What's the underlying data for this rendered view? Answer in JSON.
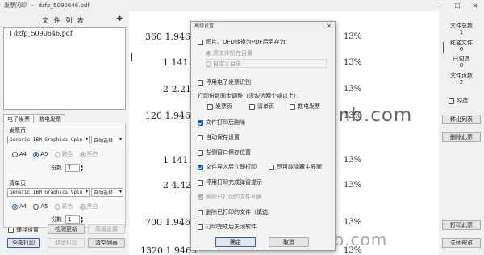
{
  "window": {
    "app_title": "发票闪印",
    "separator": "-",
    "file_title": "dzfp_5090646.pdf",
    "minimize": "—",
    "maximize": "☐",
    "close": "✕"
  },
  "file_list": {
    "header": "文 件 列 表",
    "header_icon": "✥",
    "items": [
      {
        "name": "dzfp_5090646.pdf",
        "checked": false
      }
    ]
  },
  "tabs": [
    "电子发票",
    "数电发票"
  ],
  "invoice_section": {
    "label": "发票页",
    "printer": "Generic IBM Graphics 9pin",
    "mode": "自动选择",
    "sizes": [
      "A4",
      "A5"
    ],
    "selected_size": "A5",
    "colors": [
      "彩色",
      "黑白"
    ],
    "selected_color": "黑白",
    "copies_label": "份数",
    "copies": "1"
  },
  "list_section": {
    "label": "清单页",
    "printer": "Generic IBM Graphics 9pin",
    "mode": "自动选择",
    "sizes": [
      "A4",
      "A5"
    ],
    "selected_size": "A4",
    "colors": [
      "彩色",
      "黑白"
    ],
    "selected_color": "黑白",
    "copies_label": "份数",
    "copies": "1"
  },
  "bottom_left": {
    "save_settings": "保存设置",
    "check_update": "检测更新",
    "advanced": "高级设置",
    "print_all": "全部打印",
    "cancel_print": "取消打印",
    "clear_list": "清空列表"
  },
  "preview": {
    "lines": [
      {
        "text": "360 1.9469",
        "pct": "13%"
      },
      {
        "text": "1 141.59",
        "pct": "13%"
      },
      {
        "text": "2 2.212",
        "pct": "13%"
      },
      {
        "text": "120 1.9469",
        "pct": "13%"
      },
      {
        "text": "1 141.59",
        "pct": "13%"
      },
      {
        "text": "2 4.4247",
        "pct": "13%"
      },
      {
        "text": "700 1.9469",
        "pct": "13%"
      },
      {
        "text": "1320 1.9469",
        "pct": "13%"
      }
    ],
    "watermark": "www.kuwanb.com",
    "watermark2": "www.kuwanb.com"
  },
  "right_panel": {
    "total_label": "文件总数",
    "total_value": "1",
    "red_label": "红名文件",
    "red_value": "0",
    "printed_label": "已勾选",
    "printed_value": "0",
    "pages_label": "文件页数",
    "pages_value": "2",
    "check_label": "勾选",
    "move_list": "移出列表",
    "delete_selected": "删除此票",
    "print_invoice": "打印此票",
    "close_preview": "关闭预览"
  },
  "dialog": {
    "title": "高级设置",
    "close": "✕",
    "convert_label": "图片、OFD转换为PDF后另存为:",
    "opt_same_dir": "原文件所在目录",
    "opt_custom_dir": "自定义目录",
    "custom_dir_value": "",
    "disable_ocr": "停用电子发票识别",
    "sync_label": "打印份数同步调整（须勾选两个或以上）：",
    "sync_invoice": "发票页",
    "sync_list": "清单页",
    "sync_digital": "数电发票",
    "auto_delete": "文件打印后删除",
    "auto_save": "自动保存设置",
    "remember_pos": "左侧窗口保存位置",
    "auto_print": "文件导入后立即打印",
    "hide_main": "尽可能隐藏主界面",
    "disable_tip": "停用打印完成弹窗提示",
    "delete_printed": "删除已打印的文件列表",
    "delete_printed_files": "删除已打印的文件（慎选）",
    "close_after": "打印完成后关闭软件",
    "ok": "确定",
    "cancel": "取消"
  }
}
